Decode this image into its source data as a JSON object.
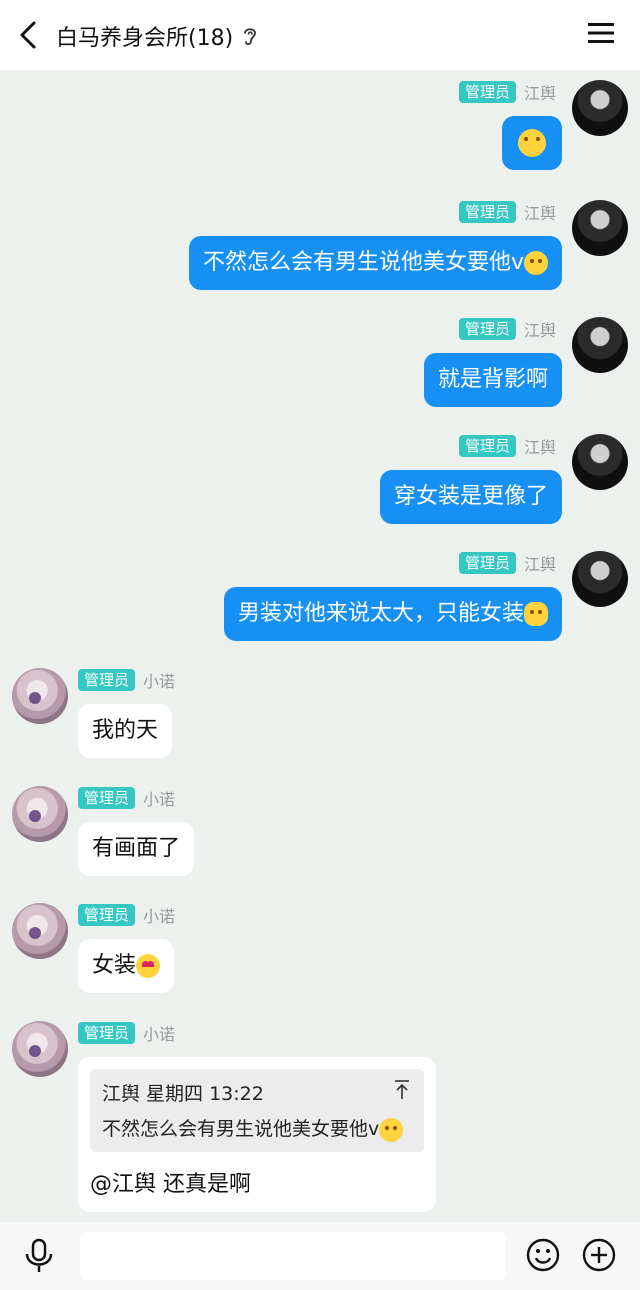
{
  "header": {
    "title": "白马养身会所(18)"
  },
  "colors": {
    "badge": "#35c7c2",
    "sent_bubble": "#1790f6",
    "background": "#edf1ee"
  },
  "messages": [
    {
      "side": "right",
      "badge": "管理员",
      "sender": "江舆",
      "text": "",
      "emoji": "smile-emoji"
    },
    {
      "side": "right",
      "badge": "管理员",
      "sender": "江舆",
      "text": "不然怎么会有男生说他美女要他v",
      "emoji": "tongue-emoji"
    },
    {
      "side": "right",
      "badge": "管理员",
      "sender": "江舆",
      "text": "就是背影啊"
    },
    {
      "side": "right",
      "badge": "管理员",
      "sender": "江舆",
      "text": "穿女装是更像了"
    },
    {
      "side": "right",
      "badge": "管理员",
      "sender": "江舆",
      "text": "男装对他来说太大，只能女装",
      "emoji": "clap-emoji"
    },
    {
      "side": "left",
      "badge": "管理员",
      "sender": "小诺",
      "text": "我的天"
    },
    {
      "side": "left",
      "badge": "管理员",
      "sender": "小诺",
      "text": "有画面了"
    },
    {
      "side": "left",
      "badge": "管理员",
      "sender": "小诺",
      "text": "女装",
      "emoji": "heart-eyes-emoji"
    },
    {
      "side": "left",
      "badge": "管理员",
      "sender": "小诺",
      "quote": {
        "head": "江舆 星期四 13:22",
        "text": "不然怎么会有男生说他美女要他v"
      },
      "reply": "@江舆 还真是啊"
    }
  ],
  "input": {
    "placeholder": ""
  }
}
